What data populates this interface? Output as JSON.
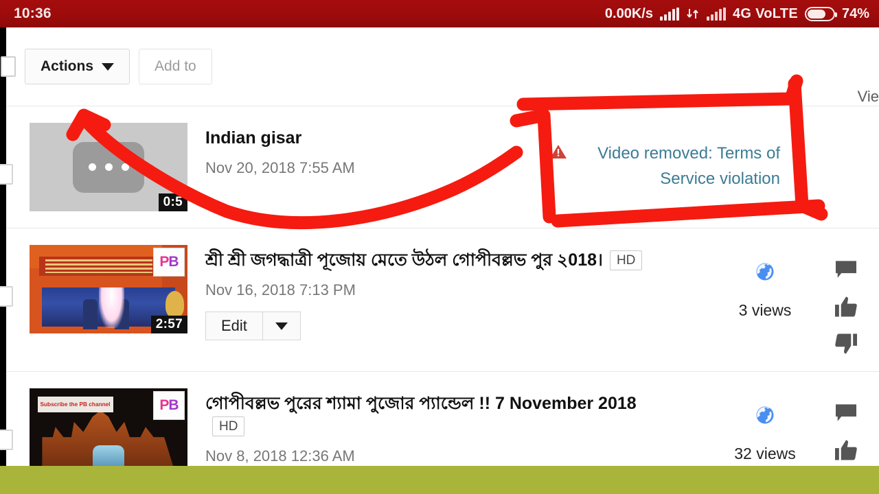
{
  "status_bar": {
    "clock": "10:36",
    "network_speed": "0.00K/s",
    "network_type": "4G VoLTE",
    "battery_percent": "74%",
    "signal_icon": "signal-bars-icon",
    "data_transfer_icon": "data-arrows-icon",
    "battery_icon": "battery-icon",
    "background_color": "#9d0b0b"
  },
  "toolbar": {
    "select_all_checkbox": "select-all-checkbox",
    "actions_label": "Actions",
    "add_to_label": "Add to",
    "views_column_header": "Vie"
  },
  "colors": {
    "annotation_red": "#f51b10",
    "link_blue": "#3c7c94",
    "warning_red": "#cf4238",
    "olive_band": "#a9b53a",
    "public_blue": "#4a8ff0"
  },
  "videos": [
    {
      "title": "Indian gisar",
      "date": "Nov 20, 2018 7:55 AM",
      "duration": "0:5",
      "thumbnail": "removed-video-placeholder",
      "status_text": "Video removed: Terms of Service violation",
      "status_icon": "warning-triangle-icon",
      "has_hd_badge": false,
      "has_edit_button": false,
      "privacy_icon": null,
      "views": null,
      "action_icons": []
    },
    {
      "title": "শ্রী শ্রী জগদ্ধাত্রী পূজোয় মেতে উঠল গোপীবল্লভ পুর ২018।",
      "hd_badge": "HD",
      "date": "Nov 16, 2018 7:13 PM",
      "duration": "2:57",
      "thumbnail": "jagaddhatri-puja-stage-thumbnail",
      "watermark": "PB",
      "edit_label": "Edit",
      "has_hd_badge": true,
      "has_edit_button": true,
      "privacy_icon": "public-globe-icon",
      "views": "3 views",
      "action_icons": [
        "comment-icon",
        "thumbs-up-icon",
        "thumbs-down-icon"
      ]
    },
    {
      "title": "গোপীবল্লভ পুরের শ্যামা পুজোর প্যান্ডেল !! 7 November 2018",
      "hd_badge": "HD",
      "date": "Nov 8, 2018 12:36 AM",
      "duration": null,
      "thumbnail": "shyama-puja-pandal-thumbnail",
      "watermark": "PB",
      "thumbnail_banner": "Subscribe the PB channel",
      "has_hd_badge": true,
      "has_edit_button": false,
      "privacy_icon": "public-globe-icon",
      "views": "32 views",
      "action_icons": [
        "comment-icon",
        "thumbs-up-icon"
      ]
    }
  ],
  "annotations": {
    "highlight_box": "red-hand-drawn-rectangle",
    "arrow": "red-hand-drawn-arrow"
  }
}
